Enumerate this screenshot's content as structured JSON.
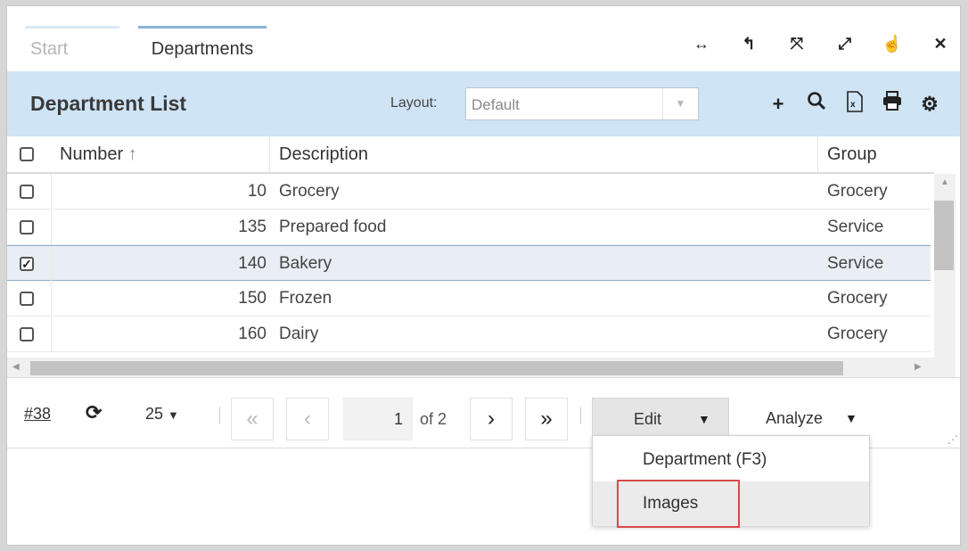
{
  "tabs": [
    {
      "label": "Start"
    },
    {
      "label": "Departments"
    }
  ],
  "window_controls": [
    "arrows-horizontal-icon",
    "undo-icon",
    "collapse-icon",
    "expand-icon",
    "pin-icon",
    "close-icon"
  ],
  "list": {
    "title": "Department List",
    "layout_label": "Layout:",
    "layout_value": "Default",
    "toolbar": [
      "add-icon",
      "search-icon",
      "excel-export-icon",
      "print-icon",
      "settings-icon"
    ]
  },
  "columns": {
    "number": "Number",
    "description": "Description",
    "group": "Group"
  },
  "rows": [
    {
      "number": "10",
      "description": "Grocery",
      "group": "Grocery",
      "checked": false
    },
    {
      "number": "135",
      "description": "Prepared food",
      "group": "Service",
      "checked": false
    },
    {
      "number": "140",
      "description": "Bakery",
      "group": "Service",
      "checked": true
    },
    {
      "number": "150",
      "description": "Frozen",
      "group": "Grocery",
      "checked": false
    },
    {
      "number": "160",
      "description": "Dairy",
      "group": "Grocery",
      "checked": false
    }
  ],
  "footer": {
    "record_count": "#38",
    "page_size": "25",
    "page": "1",
    "of_pages": "of 2",
    "edit_label": "Edit",
    "analyze_label": "Analyze"
  },
  "edit_menu": {
    "items": [
      "Department (F3)",
      "Images"
    ]
  },
  "colors": {
    "header_bg": "#cfe4f5",
    "selected_row": "#e8eef4",
    "highlight": "#d94a4a"
  }
}
